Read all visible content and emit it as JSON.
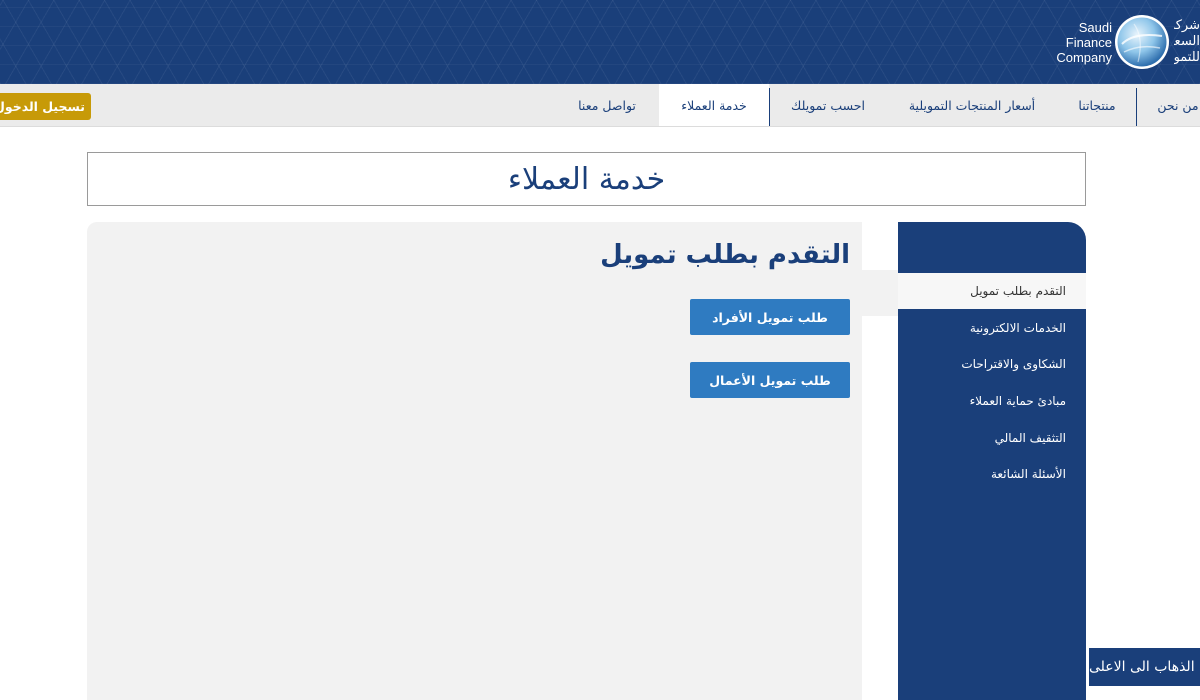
{
  "header": {
    "logo_en_lines": [
      "Saudi",
      "Finance",
      "Company"
    ],
    "logo_ar_lines": [
      "شركة",
      "السعودية",
      "للتمويل"
    ]
  },
  "nav": {
    "items": {
      "about": "من نحن",
      "products": "منتجاتنا",
      "prices": "أسعار المنتجات التمويلية",
      "calculate": "احسب تمويلك",
      "customer_service": "خدمة العملاء",
      "contact": "تواصل معنا"
    },
    "login_label": "تسجيل الدخول"
  },
  "page": {
    "title": "خدمة العملاء"
  },
  "content": {
    "heading": "التقدم بطلب تمويل",
    "btn_individuals": "طلب تمويل الأفراد",
    "btn_business": "طلب تمويل الأعمال"
  },
  "sidebar": {
    "items": [
      "التقدم بطلب تمويل",
      "الخدمات الالكترونية",
      "الشكاوى والاقتراحات",
      "مبادئ حماية العملاء",
      "التثقيف المالي",
      "الأسئلة الشائعة"
    ]
  },
  "footer": {
    "back_to_top": "الذهاب الى الاعلى"
  },
  "colors": {
    "brand_navy": "#1a3f7a",
    "login_gold": "#c79a08",
    "action_blue": "#2f7bc1"
  }
}
